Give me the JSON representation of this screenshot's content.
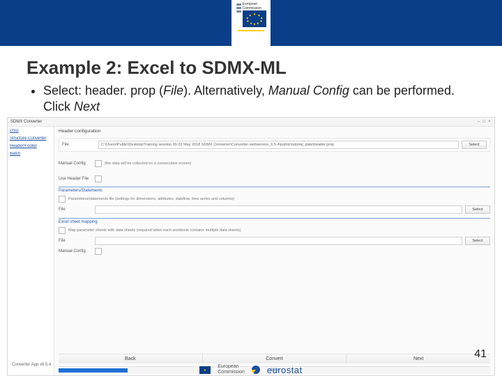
{
  "header": {
    "ec_label_line1": "European",
    "ec_label_line2": "Commission"
  },
  "title": "Example 2: Excel to SDMX-ML",
  "bullet": {
    "lead": "Select: header. prop (",
    "file_italic": "File",
    "mid": "). Alternatively, ",
    "manual_italic": "Manual Config",
    "tail": " can be performed. Click ",
    "next_italic": "Next"
  },
  "app": {
    "window_title": "SDMX Converter",
    "win_min": "–",
    "win_max": "□",
    "win_close": "×",
    "sidebar": {
      "items": [
        {
          "label": "DSD"
        },
        {
          "label": "Structure Converter"
        },
        {
          "label": "Header/Footer"
        },
        {
          "label": "Batch"
        }
      ]
    },
    "main": {
      "panel_title": "Header configuration",
      "file_label": "File",
      "file_value": "C:\\Users\\Public\\Desktop\\Training session 30-31 May 2018 SDMX Converter\\Converter-webservice_6.5.4\\public\\tutorial_data\\header.prop",
      "select_btn": "Select",
      "manual_label": "Manual Config",
      "manual_note": "(the data will be collected on a consecutive screen)",
      "use_header_label": "Use Header File",
      "params_section": "Parameters/Statements",
      "params_checkbox_note": "Parameters/statements file (settings for dimensions, attributes, dataflow, time series and columns)",
      "params_file_label": "File",
      "params_select_btn": "Select",
      "mapping_section": "Excel sheet mapping",
      "mapping_checkbox_note": "Map parameter sheets with data sheets (required when each workbook contains multiple data sheets)",
      "mapping_file_label": "File",
      "mapping_select_btn": "Select",
      "manual_config_row": "Manual Config",
      "footer_version": "Converter App v6.5.4"
    },
    "footer_buttons": {
      "back": "Back",
      "convert": "Convert",
      "next": "Next"
    },
    "progress": {
      "percent_label": "16%"
    }
  },
  "footer": {
    "ec_line1": "European",
    "ec_line2": "Commission",
    "eurostat": "eurostat"
  },
  "page_number": "41"
}
